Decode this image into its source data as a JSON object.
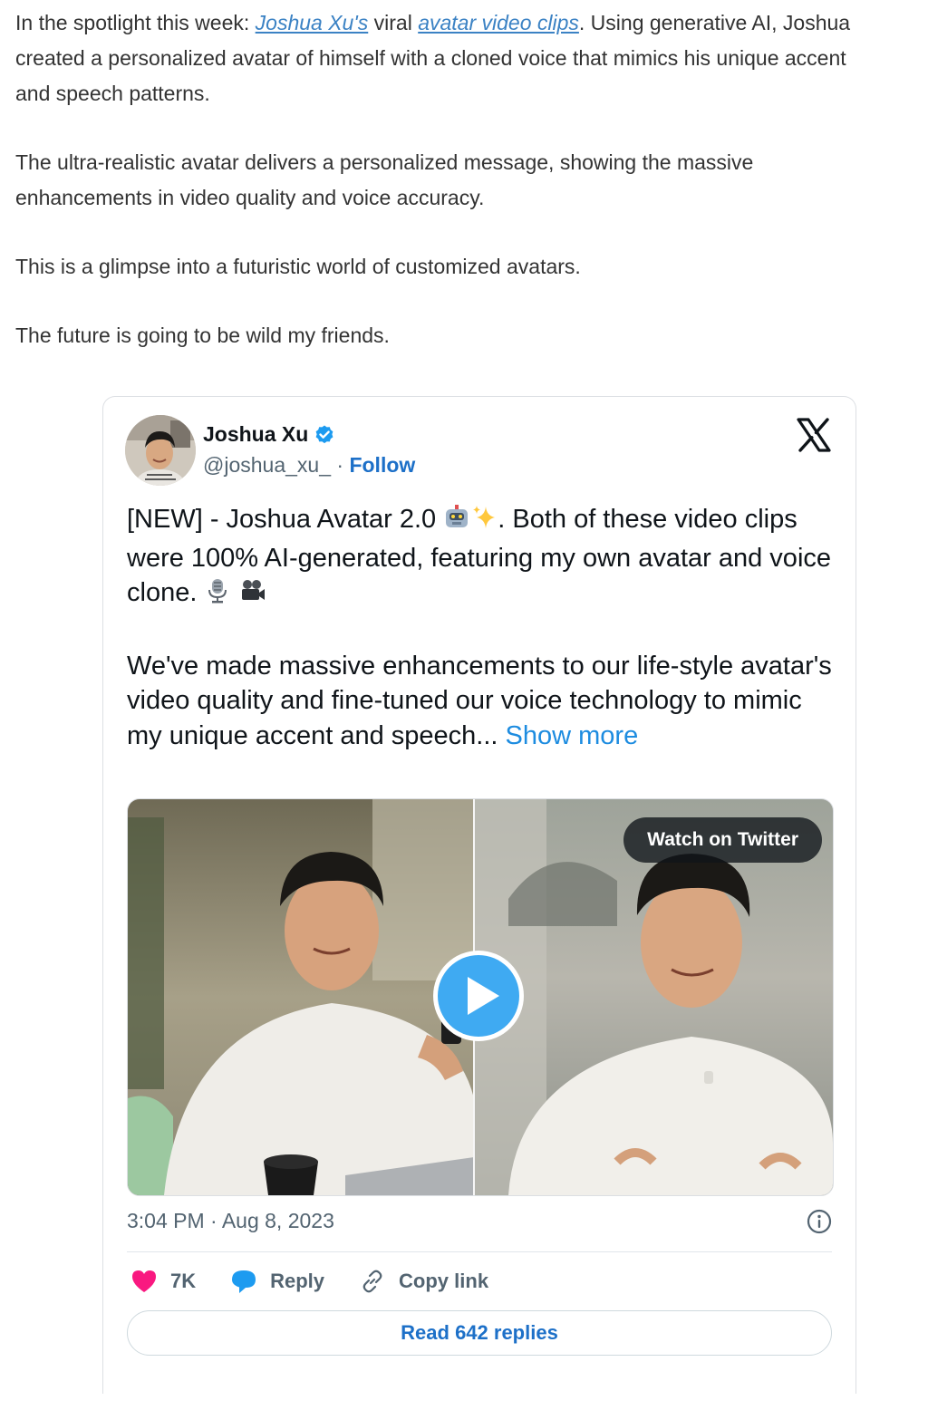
{
  "article": {
    "p1_prefix": "In the spotlight this week: ",
    "p1_link1": "Joshua Xu's",
    "p1_mid": " viral ",
    "p1_link2": "avatar video clips",
    "p1_suffix": ". Using generative AI, Joshua created a personalized avatar of himself with a cloned voice that mimics his unique accent and speech patterns.",
    "p2": "The ultra-realistic avatar delivers a personalized message, showing the massive enhancements in video quality and voice accuracy.",
    "p3": "This is a glimpse into a futuristic world of customized avatars.",
    "p4": "The future is going to be wild my friends."
  },
  "tweet": {
    "author_name": "Joshua Xu",
    "handle": "@joshua_xu_",
    "separator": " · ",
    "follow_label": "Follow",
    "text_p1_a": "[NEW] - Joshua Avatar 2.0 ",
    "text_p1_b": ". Both of these video clips were 100% AI-generated, featuring my own avatar and voice clone. ",
    "text_p2": "We've made massive enhancements to our life-style avatar's video quality and fine-tuned our voice technology to mimic my unique accent and speech... ",
    "show_more": "Show more",
    "watch_label": "Watch on Twitter",
    "timestamp": "3:04 PM · Aug 8, 2023",
    "likes": "7K",
    "reply_label": "Reply",
    "copy_link_label": "Copy link",
    "read_replies_label": "Read 642 replies"
  },
  "colors": {
    "link": "#3b82c4",
    "follow": "#1d70c8",
    "show_more": "#1d8ce0",
    "heart": "#f91880",
    "reply_bubble": "#1d9bf0",
    "play_button": "#1d9bf0"
  },
  "icons": [
    "verified-badge-icon",
    "x-logo-icon",
    "robot-emoji",
    "sparkles-emoji",
    "microphone-emoji",
    "movie-camera-emoji",
    "play-icon",
    "info-icon",
    "heart-icon",
    "reply-bubble-icon",
    "link-icon"
  ]
}
